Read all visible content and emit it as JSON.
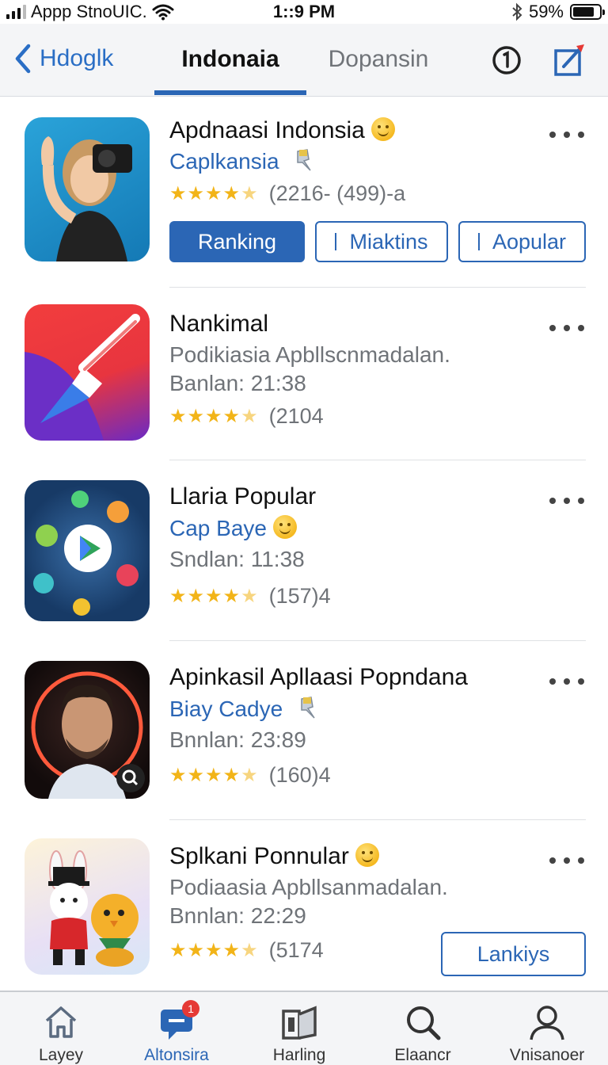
{
  "status_bar": {
    "carrier": "Appp StnoUIC.",
    "time": "1::9 PM",
    "battery": "59%"
  },
  "header": {
    "back_label": "Hdoglk",
    "tabs": [
      {
        "label": "Indonaia",
        "active": true
      },
      {
        "label": "Dopansin",
        "active": false
      }
    ],
    "info_icon": "info-circle-icon",
    "compose_icon": "compose-icon"
  },
  "apps": [
    {
      "title": "Apdnaasi Indonsia",
      "subtitle": "Caplkansia",
      "rating_text": "(2216- (499)-a",
      "stars": 4.5,
      "buttons": [
        "Ranking",
        "Miaktins",
        "Aopular"
      ]
    },
    {
      "title": "Nankimal",
      "subtitle": "Podikiasia Apbllscnmadalan.",
      "meta": "Banlan: 21:38",
      "rating_text": "(2104",
      "stars": 4.5
    },
    {
      "title": "Llaria Popular",
      "subtitle": "Cap Baye",
      "meta": "Sndlan: 11:38",
      "rating_text": "(157)4",
      "stars": 4.5
    },
    {
      "title": "Apinkasil Apllaasi Popndana",
      "subtitle": "Biay Cadye",
      "meta": "Bnnlan: 23:89",
      "rating_text": "(160)4",
      "stars": 4.5
    },
    {
      "title": "Splkani Ponnular",
      "subtitle": "Podiaasia Apbllsanmadalan.",
      "meta": "Bnnlan: 22:29",
      "rating_text": "(5174",
      "stars": 4.5,
      "action_button": "Lankiys"
    }
  ],
  "tabbar": {
    "items": [
      {
        "label": "Layey",
        "icon": "home-icon"
      },
      {
        "label": "Altonsira",
        "icon": "chat-icon",
        "badge": "1",
        "active": true
      },
      {
        "label": "Harling",
        "icon": "news-icon"
      },
      {
        "label": "Elaancr",
        "icon": "search-icon"
      },
      {
        "label": "Vnisanoer",
        "icon": "person-icon"
      }
    ]
  },
  "colors": {
    "accent": "#2b66b5",
    "star": "#f2b418",
    "badge": "#e53935"
  }
}
